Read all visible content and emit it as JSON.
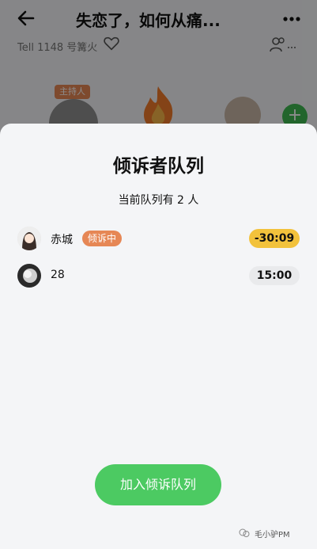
{
  "room": {
    "title": "失恋了，如何从痛...",
    "id_label": "Tell 1148 号篝火",
    "host_badge": "主持人",
    "add_seat_label": "+"
  },
  "sheet": {
    "title": "倾诉者队列",
    "count_text": "当前队列有 2 人",
    "queue": [
      {
        "name": "赤城",
        "badge": "倾诉中",
        "time": "-30:09",
        "status": "overtime"
      },
      {
        "name": "28",
        "badge": "",
        "time": "15:00",
        "status": "waiting"
      }
    ],
    "join_button": "加入倾诉队列"
  },
  "watermark": "毛小驴PM",
  "colors": {
    "accent_green": "#4cca62",
    "badge_orange": "#e68755",
    "overtime_yellow": "#f2c23c"
  }
}
